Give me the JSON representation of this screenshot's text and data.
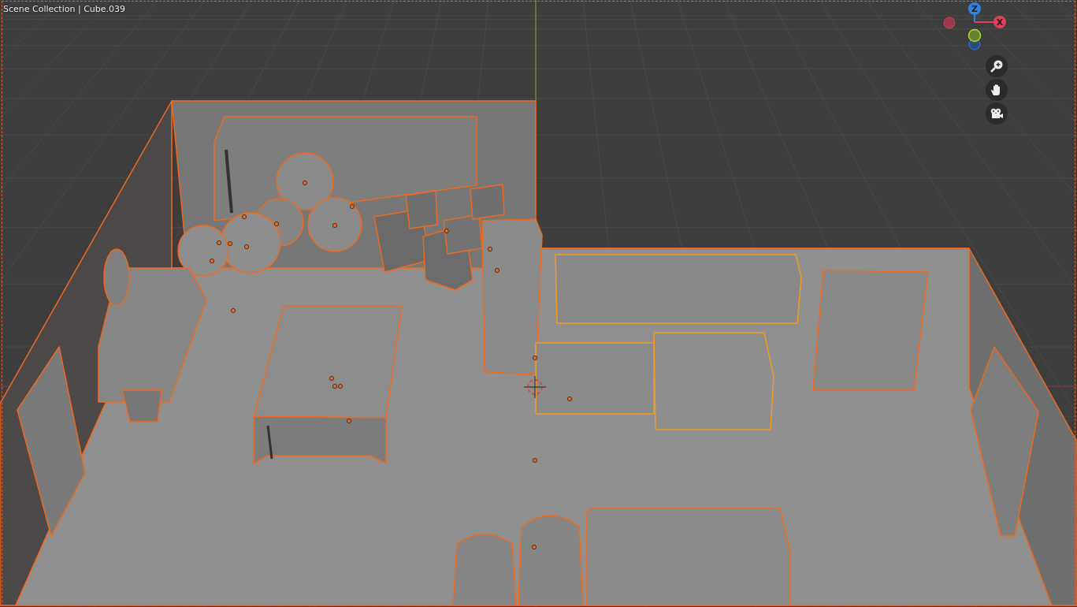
{
  "viewport": {
    "header": "Scene Collection | Cube.039"
  },
  "gizmo": {
    "axes": [
      {
        "label": "Z",
        "kind": "z"
      },
      {
        "label": "X",
        "kind": "x"
      }
    ]
  },
  "navigation": [
    {
      "kind": "zoom"
    },
    {
      "kind": "pan"
    },
    {
      "kind": "camera"
    }
  ]
}
